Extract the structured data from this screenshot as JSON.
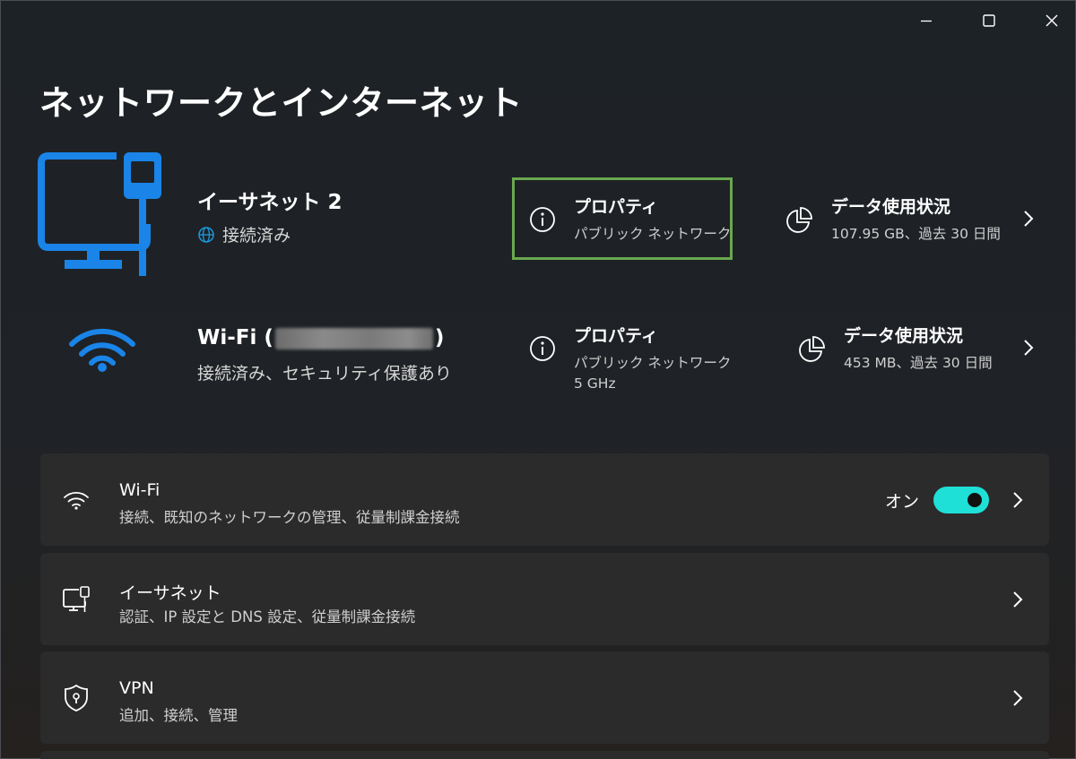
{
  "window": {
    "minimize_label": "Minimize",
    "maximize_label": "Maximize",
    "close_label": "Close"
  },
  "page": {
    "title": "ネットワークとインターネット"
  },
  "ethernet_connection": {
    "name": "イーサネット 2",
    "status": "接続済み",
    "properties_title": "プロパティ",
    "properties_sub": "パブリック ネットワーク",
    "usage_title": "データ使用状況",
    "usage_sub": "107.95 GB、過去 30 日間"
  },
  "wifi_connection": {
    "name_prefix": "Wi-Fi (",
    "name_suffix": ")",
    "status": "接続済み、セキュリティ保護あり",
    "properties_title": "プロパティ",
    "properties_sub": "パブリック ネットワーク",
    "properties_band": "5 GHz",
    "usage_title": "データ使用状況",
    "usage_sub": "453 MB、過去 30 日間"
  },
  "cards": {
    "wifi": {
      "title": "Wi-Fi",
      "subtitle": "接続、既知のネットワークの管理、従量制課金接続",
      "toggle_label": "オン",
      "toggle_on": true
    },
    "ethernet": {
      "title": "イーサネット",
      "subtitle": "認証、IP 設定と DNS 設定、従量制課金接続"
    },
    "vpn": {
      "title": "VPN",
      "subtitle": "追加、接続、管理"
    }
  },
  "colors": {
    "accent_blue": "#1a84e8",
    "toggle_on": "#1fe0d6",
    "highlight_border": "#6aa84f",
    "card_bg": "#2b2b2c"
  },
  "icons": {
    "ethernet_hero": "monitor-with-cable-icon",
    "wifi_hero": "wifi-signal-icon",
    "globe": "globe-icon",
    "info": "info-icon",
    "usage": "pie-chart-icon",
    "chevron": "chevron-right-icon",
    "vpn": "shield-icon"
  }
}
